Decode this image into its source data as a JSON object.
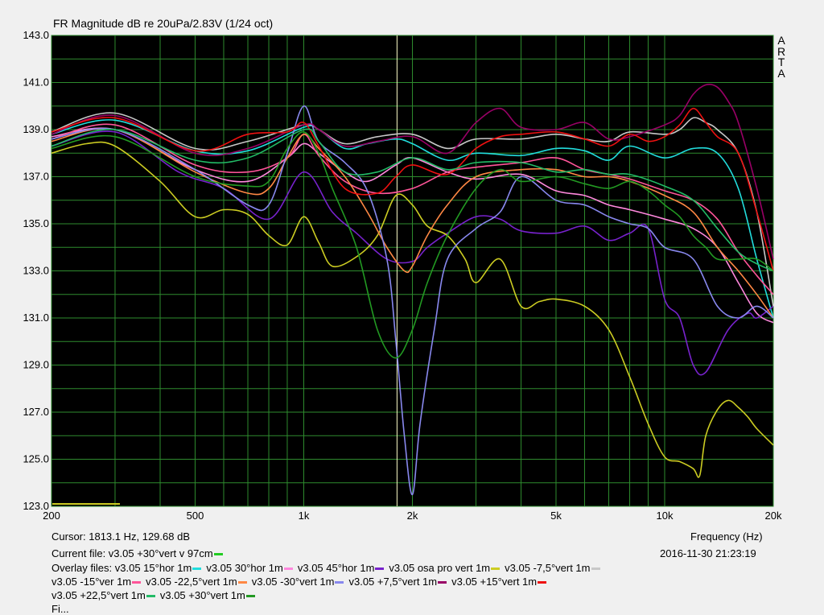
{
  "colors": {
    "background": "#f0f0f0",
    "plot_bg": "#000000",
    "grid": "#2e8b2e",
    "cursor": "#ffffc8"
  },
  "header": {
    "title": "FR Magnitude dB re 20uPa/2.83V (1/24 oct)",
    "side_label": [
      "A",
      "R",
      "T",
      "A"
    ]
  },
  "footer": {
    "cursor": "Cursor:  1813.1 Hz, 129.68 dB",
    "frequency_label": "Frequency (Hz)",
    "current_file": "Current file: v3.05 +30°vert v 97cm",
    "current_color": "#22cc22",
    "date": "2016-11-30   21:23:19",
    "overlay_prefix": "Overlay files:",
    "partial_line": "Fi..."
  },
  "chart_data": {
    "type": "line",
    "title": "FR Magnitude dB re 20uPa/2.83V (1/24 oct)",
    "xlabel": "Frequency (Hz)",
    "ylabel": "",
    "x_scale": "log",
    "xlim": [
      200,
      20000
    ],
    "ylim": [
      123,
      143
    ],
    "x_ticks": [
      {
        "value": 200,
        "label": "200"
      },
      {
        "value": 500,
        "label": "500"
      },
      {
        "value": 1000,
        "label": "1k"
      },
      {
        "value": 2000,
        "label": "2k"
      },
      {
        "value": 5000,
        "label": "5k"
      },
      {
        "value": 10000,
        "label": "10k"
      },
      {
        "value": 20000,
        "label": "20k"
      }
    ],
    "y_ticks": [
      {
        "value": 123,
        "label": "123.0"
      },
      {
        "value": 125,
        "label": "125.0"
      },
      {
        "value": 127,
        "label": "127.0"
      },
      {
        "value": 129,
        "label": "129.0"
      },
      {
        "value": 131,
        "label": "131.0"
      },
      {
        "value": 133,
        "label": "133.0"
      },
      {
        "value": 135,
        "label": "135.0"
      },
      {
        "value": 137,
        "label": "137.0"
      },
      {
        "value": 139,
        "label": "139.0"
      },
      {
        "value": 141,
        "label": "141.0"
      },
      {
        "value": 143,
        "label": "143.0"
      }
    ],
    "grid": true,
    "cursor_x": 1813.1,
    "series": [
      {
        "name": "v3.05 15°hor 1m",
        "color": "#22dddd",
        "x": [
          200,
          300,
          500,
          700,
          1000,
          1100,
          1300,
          1500,
          1800,
          2000,
          2500,
          3000,
          4000,
          5000,
          6000,
          7000,
          8000,
          10000,
          12000,
          14000,
          16000,
          18000,
          20000
        ],
        "y": [
          138.8,
          139.4,
          138.1,
          138.1,
          139.1,
          139.0,
          138.2,
          138.4,
          138.6,
          138.4,
          137.7,
          138.0,
          137.9,
          138.2,
          138.1,
          137.7,
          138.3,
          137.8,
          138.2,
          138.0,
          136.5,
          133.5,
          131.0
        ]
      },
      {
        "name": "v3.05 30°hor 1m",
        "color": "#ff88dd",
        "x": [
          200,
          300,
          500,
          700,
          900,
          1000,
          1100,
          1300,
          1500,
          1800,
          2000,
          2500,
          3000,
          4000,
          5000,
          6000,
          7000,
          8000,
          10000,
          12000,
          14000,
          16000,
          18000,
          20000
        ],
        "y": [
          138.7,
          139.0,
          137.3,
          136.8,
          137.8,
          138.4,
          138.0,
          137.2,
          136.8,
          137.5,
          137.8,
          137.2,
          136.9,
          137.1,
          136.4,
          136.2,
          135.8,
          135.6,
          135.2,
          134.8,
          134.0,
          132.5,
          131.2,
          130.8
        ]
      },
      {
        "name": "v3.05 45°hor 1m",
        "color": "#7722cc",
        "x": [
          200,
          300,
          450,
          600,
          800,
          1000,
          1200,
          1400,
          1700,
          2000,
          2200,
          2500,
          3000,
          3500,
          4000,
          5000,
          6000,
          7000,
          8000,
          9000,
          10000,
          11000,
          12000,
          13000,
          15000,
          17000,
          18000,
          20000
        ],
        "y": [
          138.3,
          138.9,
          137.2,
          136.5,
          135.2,
          137.2,
          135.5,
          134.6,
          133.5,
          133.4,
          134.0,
          134.6,
          135.3,
          135.2,
          134.7,
          134.6,
          134.9,
          134.3,
          134.6,
          134.8,
          131.8,
          131.0,
          129.0,
          128.7,
          130.5,
          131.2,
          131.0,
          131.5
        ]
      },
      {
        "name": "v3.05 osa pro vert 1m",
        "color": "#cccc22",
        "x": [
          200,
          250,
          300,
          400,
          500,
          600,
          700,
          800,
          900,
          1000,
          1100,
          1200,
          1400,
          1600,
          1800,
          2000,
          2200,
          2500,
          2800,
          3000,
          3500,
          4000,
          4500,
          5000,
          6000,
          7000,
          8000,
          9000,
          10000,
          11000,
          12000,
          12500,
          13000,
          14000,
          15000,
          16000,
          17000,
          18000,
          20000
        ],
        "y": [
          138.0,
          138.4,
          138.3,
          136.8,
          135.3,
          135.6,
          135.4,
          134.5,
          134.1,
          135.3,
          134.2,
          133.2,
          133.6,
          134.5,
          136.2,
          135.8,
          134.9,
          134.5,
          133.5,
          132.5,
          133.5,
          131.5,
          131.7,
          131.8,
          131.5,
          130.5,
          128.5,
          126.5,
          125.1,
          124.9,
          124.6,
          124.3,
          126.0,
          127.1,
          127.5,
          127.2,
          126.8,
          126.3,
          125.6
        ]
      },
      {
        "name": "v3.05 -7,5°vert 1m",
        "color": "#c8c8c8",
        "x": [
          200,
          300,
          500,
          700,
          1000,
          1100,
          1300,
          1600,
          2000,
          2500,
          3000,
          4000,
          5000,
          6000,
          7000,
          8000,
          10000,
          11000,
          12000,
          13000,
          14000,
          16000,
          18000,
          20000
        ],
        "y": [
          138.9,
          139.7,
          138.2,
          138.5,
          139.2,
          139.0,
          138.4,
          138.7,
          138.8,
          138.2,
          138.6,
          138.6,
          138.8,
          138.6,
          138.5,
          138.9,
          138.8,
          139.0,
          139.5,
          139.3,
          139.0,
          138.0,
          135.5,
          131.5
        ]
      },
      {
        "name": "v3.05 -15°ver 1m",
        "color": "#ff5599",
        "x": [
          200,
          300,
          500,
          700,
          900,
          1000,
          1100,
          1300,
          1600,
          2000,
          2500,
          3000,
          4000,
          5000,
          6000,
          7000,
          8000,
          10000,
          12000,
          14000,
          16000,
          18000,
          20000
        ],
        "y": [
          138.6,
          139.2,
          137.5,
          137.2,
          137.8,
          138.8,
          137.9,
          136.8,
          136.3,
          136.5,
          137.2,
          137.4,
          137.6,
          137.8,
          137.3,
          137.1,
          136.9,
          136.4,
          136.0,
          135.2,
          133.8,
          132.8,
          132.0
        ]
      },
      {
        "name": "v3.05 -22,5°vert 1m",
        "color": "#ff8844",
        "x": [
          200,
          300,
          500,
          700,
          800,
          900,
          1000,
          1100,
          1300,
          1500,
          1700,
          1900,
          2000,
          2200,
          2500,
          3000,
          4000,
          5000,
          6000,
          7000,
          8000,
          10000,
          12000,
          14000,
          16000,
          18000,
          20000
        ],
        "y": [
          138.5,
          139.0,
          137.2,
          136.3,
          136.5,
          137.8,
          138.8,
          138.2,
          137.0,
          135.5,
          134.0,
          133.0,
          133.2,
          134.5,
          135.8,
          137.0,
          137.3,
          137.3,
          137.0,
          137.0,
          136.8,
          136.2,
          135.5,
          134.0,
          133.0,
          132.0,
          131.0
        ]
      },
      {
        "name": "v3.05 -30°vert 1m",
        "color": "#8888ee",
        "x": [
          200,
          300,
          500,
          700,
          800,
          900,
          1000,
          1100,
          1300,
          1500,
          1700,
          1800,
          1900,
          2000,
          2100,
          2300,
          2500,
          3000,
          3500,
          4000,
          5000,
          6000,
          7000,
          8000,
          9000,
          10000,
          12000,
          14000,
          16000,
          18000,
          20000
        ],
        "y": [
          138.6,
          139.0,
          137.3,
          135.8,
          135.8,
          138.0,
          140.0,
          138.5,
          137.6,
          136.4,
          133.5,
          130.0,
          126.0,
          123.5,
          126.5,
          130.5,
          133.5,
          134.8,
          135.5,
          137.0,
          136.0,
          135.8,
          135.3,
          135.0,
          134.8,
          134.0,
          133.5,
          131.5,
          131.0,
          131.5,
          131.0
        ]
      },
      {
        "name": "v3.05 +7,5°vert 1m",
        "color": "#990066",
        "x": [
          200,
          300,
          500,
          700,
          1000,
          1100,
          1300,
          1600,
          2000,
          2500,
          3000,
          3500,
          4000,
          5000,
          6000,
          7000,
          8000,
          10000,
          11000,
          12000,
          13000,
          14000,
          15000,
          16000,
          18000,
          20000
        ],
        "y": [
          138.8,
          139.6,
          138.0,
          138.2,
          139.2,
          139.0,
          138.3,
          138.5,
          138.7,
          138.0,
          139.3,
          139.9,
          139.1,
          139.0,
          139.3,
          138.6,
          138.7,
          139.2,
          139.6,
          140.5,
          140.9,
          140.8,
          140.2,
          139.3,
          136.5,
          133.5
        ]
      },
      {
        "name": "v3.05 +15°vert 1m",
        "color": "#ee1111",
        "x": [
          200,
          300,
          500,
          700,
          900,
          1000,
          1100,
          1300,
          1600,
          1800,
          2000,
          2500,
          3000,
          3500,
          4000,
          5000,
          6000,
          7000,
          8000,
          9000,
          10000,
          11000,
          12000,
          13000,
          14000,
          16000,
          18000,
          20000
        ],
        "y": [
          138.9,
          139.5,
          138.1,
          138.8,
          138.9,
          139.3,
          138.3,
          136.5,
          136.3,
          137.0,
          137.5,
          137.1,
          138.2,
          138.7,
          138.8,
          138.9,
          138.6,
          138.3,
          138.8,
          138.5,
          138.7,
          139.2,
          139.9,
          139.3,
          138.7,
          138.0,
          135.5,
          133.0
        ]
      },
      {
        "name": "v3.05 +22,5°vert 1m",
        "color": "#22bb66",
        "x": [
          200,
          300,
          500,
          700,
          1000,
          1100,
          1300,
          1600,
          2000,
          2500,
          3000,
          4000,
          5000,
          6000,
          7000,
          8000,
          10000,
          12000,
          14000,
          16000,
          18000,
          20000
        ],
        "y": [
          138.3,
          139.0,
          137.7,
          137.8,
          139.0,
          138.5,
          137.2,
          137.2,
          137.8,
          137.3,
          137.6,
          137.6,
          137.2,
          137.3,
          137.1,
          137.1,
          136.6,
          136.0,
          134.8,
          133.8,
          133.3,
          133.0
        ]
      },
      {
        "name": "v3.05 +30°vert 1m",
        "color": "#229922",
        "x": [
          200,
          300,
          500,
          700,
          800,
          900,
          1000,
          1100,
          1200,
          1400,
          1600,
          1800,
          2000,
          2200,
          2500,
          3000,
          3500,
          4000,
          5000,
          6000,
          7000,
          8000,
          9000,
          10000,
          11000,
          12000,
          13000,
          14000,
          16000,
          18000,
          20000
        ],
        "y": [
          138.2,
          138.7,
          137.0,
          136.6,
          136.8,
          138.2,
          138.9,
          138.0,
          136.5,
          134.0,
          130.5,
          129.3,
          130.5,
          132.5,
          134.5,
          136.5,
          137.3,
          136.8,
          137.0,
          136.7,
          136.5,
          136.8,
          136.4,
          135.8,
          135.3,
          134.5,
          134.0,
          133.5,
          133.5,
          133.5,
          133.0
        ]
      }
    ]
  }
}
